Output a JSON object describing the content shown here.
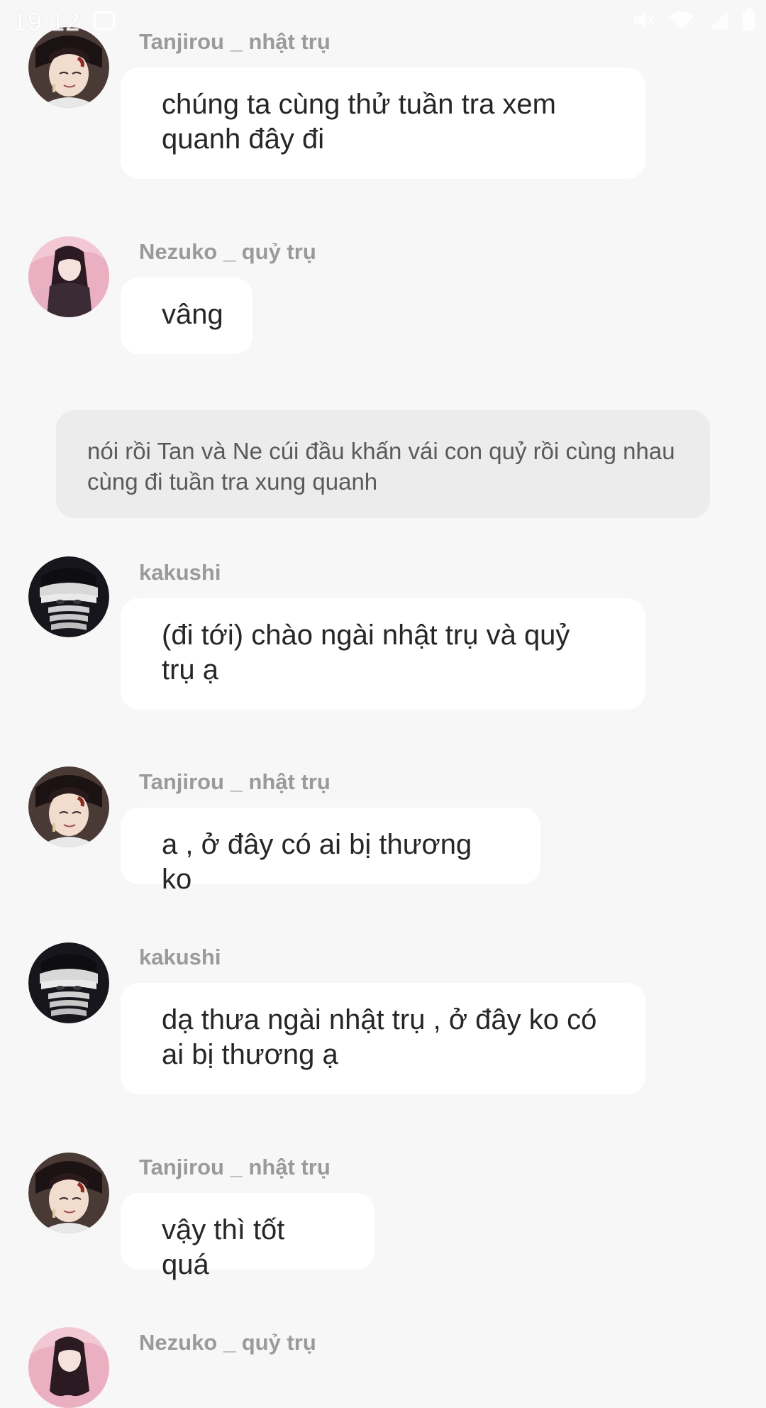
{
  "status_bar": {
    "time": "19:12",
    "icons": [
      "image-icon",
      "mute-icon",
      "wifi-icon",
      "signal-icon",
      "battery-icon"
    ]
  },
  "messages": [
    {
      "sender": "Tanjirou _ nhật trụ",
      "avatar": "tanjirou-avatar",
      "text": "chúng ta cùng thử tuần tra xem quanh đây đi"
    },
    {
      "sender": "Nezuko _ quỷ trụ",
      "avatar": "nezuko-avatar",
      "text": "vâng"
    },
    {
      "sender": "kakushi",
      "avatar": "kakushi-avatar",
      "text": "(đi tới) chào ngài nhật trụ và quỷ trụ ạ"
    },
    {
      "sender": "Tanjirou _ nhật trụ",
      "avatar": "tanjirou-avatar",
      "text": "a , ở đây có ai bị thương ko"
    },
    {
      "sender": "kakushi",
      "avatar": "kakushi-avatar",
      "text": "dạ thưa ngài nhật trụ , ở đây ko có ai bị thương ạ"
    },
    {
      "sender": "Tanjirou _ nhật trụ",
      "avatar": "tanjirou-avatar",
      "text": "vậy thì tốt quá"
    },
    {
      "sender": "Nezuko _ quỷ trụ",
      "avatar": "nezuko-avatar",
      "text": ""
    }
  ],
  "narration": {
    "text": "nói rồi Tan và Ne cúi đầu khấn vái con quỷ rồi cùng nhau cùng đi tuần tra xung quanh"
  }
}
